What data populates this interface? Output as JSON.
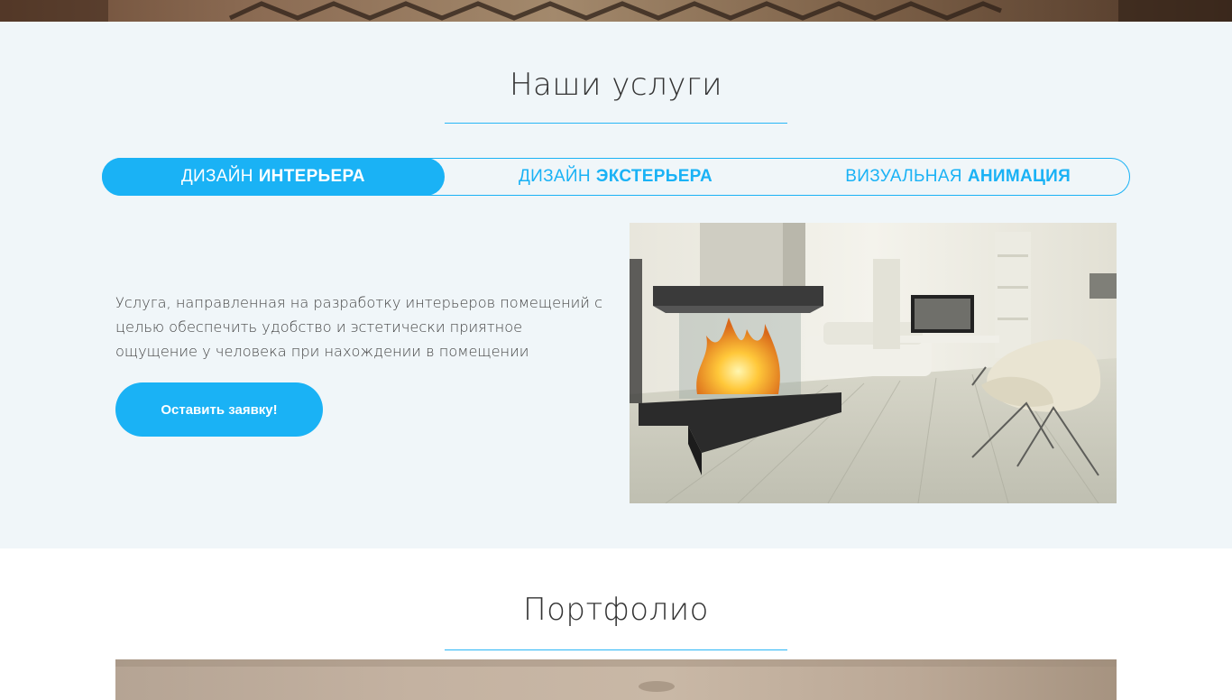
{
  "services": {
    "title": "Наши услуги",
    "tabs": [
      {
        "light": "Дизайн",
        "bold": "интерьера",
        "active": true
      },
      {
        "light": "Дизайн",
        "bold": "экстерьера",
        "active": false
      },
      {
        "light": "Визуальная",
        "bold": "анимация",
        "active": false
      }
    ],
    "description": "Услуга, направленная на разработку интерьеров помещений с целью обеспечить удобство и эстетически приятное ощущение у человека при нахождении в помещении",
    "cta_label": "Оставить заявку!",
    "image_icon": "interior-fireplace-photo"
  },
  "portfolio": {
    "title": "Портфолио",
    "image_icon": "portfolio-photo"
  },
  "colors": {
    "accent": "#1ab2f5",
    "section_bg": "#f0f6f9",
    "underline": "#29b6f6"
  }
}
